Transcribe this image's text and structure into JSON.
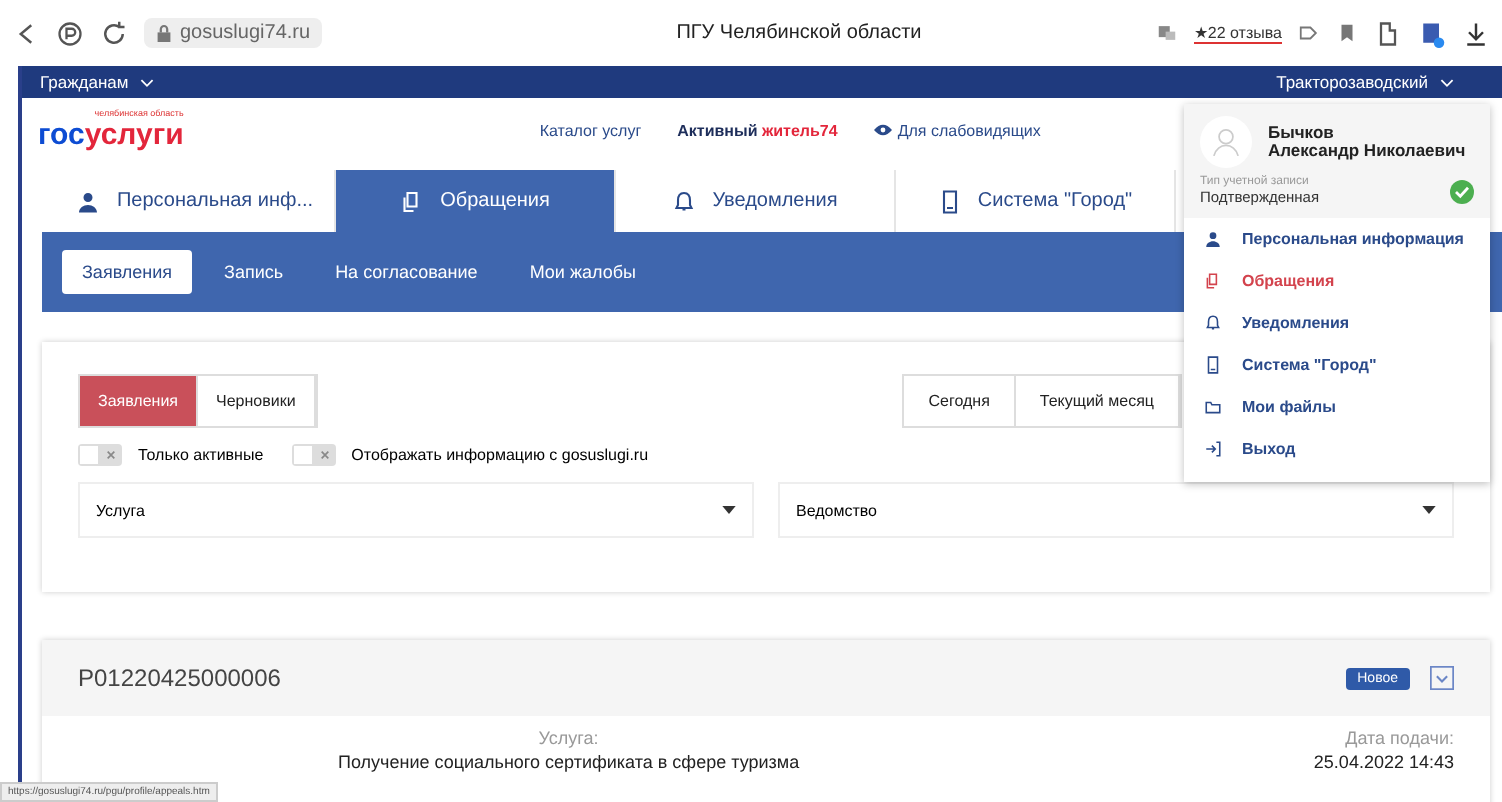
{
  "browser": {
    "url": "gosuslugi74.ru",
    "title": "ПГУ Челябинской области",
    "reviews": "★22 отзыва"
  },
  "topbar": {
    "menu": "Гражданам",
    "district": "Тракторозаводский"
  },
  "header": {
    "logo_region": "челябинская область",
    "logo_first": "гос",
    "logo_second": "услуги",
    "catalog": "Каталог услуг",
    "active_first": "Активный ",
    "active_second": "житель74",
    "accessibility": "Для слабовидящих"
  },
  "tabs": [
    {
      "label": "Персональная инф...",
      "selected": false
    },
    {
      "label": "Обращения",
      "selected": true
    },
    {
      "label": "Уведомления",
      "selected": false
    },
    {
      "label": "Система \"Город\"",
      "selected": false
    }
  ],
  "subtabs": [
    {
      "label": "Заявления",
      "selected": true
    },
    {
      "label": "Запись",
      "selected": false
    },
    {
      "label": "На согласование",
      "selected": false
    },
    {
      "label": "Мои жалобы",
      "selected": false
    }
  ],
  "segments": [
    {
      "label": "Заявления",
      "selected": true
    },
    {
      "label": "Черновики",
      "selected": false
    }
  ],
  "periods": [
    {
      "label": "Сегодня"
    },
    {
      "label": "Текущий месяц"
    }
  ],
  "toggles": [
    {
      "label": "Только активные",
      "on": false
    },
    {
      "label": "Отображать информацию с gosuslugi.ru",
      "on": false
    }
  ],
  "selects": [
    {
      "placeholder": "Услуга"
    },
    {
      "placeholder": "Ведомство"
    }
  ],
  "appeal": {
    "number": "P01220425000006",
    "status": "Новое",
    "service_label": "Услуга:",
    "service": "Получение социального сертификата в сфере туризма",
    "date_label": "Дата подачи:",
    "date": "25.04.2022 14:43"
  },
  "user_menu": {
    "last_name": "Бычков",
    "first_names": "Александр Николаевич",
    "account_label": "Тип учетной записи",
    "account_type": "Подтвержденная",
    "verified": true,
    "items": [
      {
        "label": "Персональная информация",
        "selected": false
      },
      {
        "label": "Обращения",
        "selected": true
      },
      {
        "label": "Уведомления",
        "selected": false
      },
      {
        "label": "Система \"Город\"",
        "selected": false
      },
      {
        "label": "Мои файлы",
        "selected": false
      },
      {
        "label": "Выход",
        "selected": false
      }
    ]
  },
  "status_url": "https://gosuslugi74.ru/pgu/profile/appeals.htm"
}
